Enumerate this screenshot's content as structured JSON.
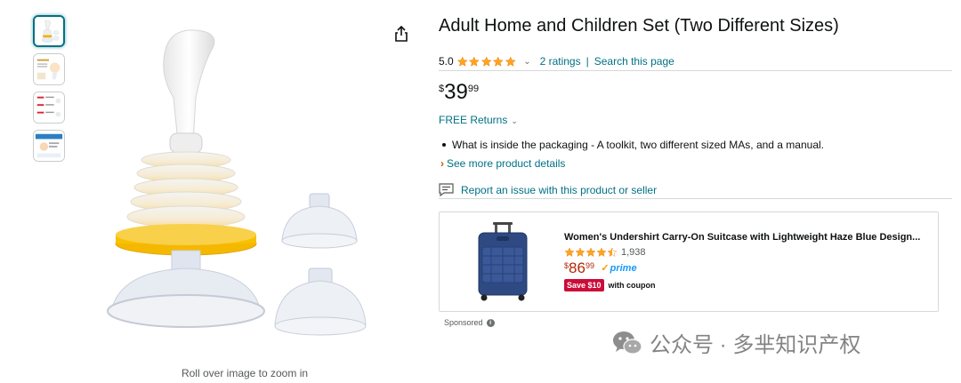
{
  "gallery": {
    "thumbnails": [
      "product-photo",
      "infographic",
      "size-comparison",
      "usage-guide"
    ],
    "zoom_hint": "Roll over image to zoom in"
  },
  "product": {
    "title": "Adult Home and Children Set (Two Different Sizes)",
    "rating_value": "5.0",
    "stars": 5,
    "ratings_link": "2 ratings",
    "search_link": "Search this page",
    "price_symbol": "$",
    "price_whole": "39",
    "price_fraction": "99",
    "returns": "FREE Returns",
    "bullet": "What is inside the packaging - A toolkit, two different sized MAs, and a manual.",
    "see_more": "See more product details",
    "report": "Report an issue with this product or seller"
  },
  "sponsored_ad": {
    "title": "Women's Undershirt Carry-On Suitcase with Lightweight Haze Blue Design...",
    "stars": 4.5,
    "rating_count": "1,938",
    "price_symbol": "$",
    "price_whole": "86",
    "price_fraction": "99",
    "prime": "prime",
    "coupon_badge": "Save $10",
    "coupon_text": "with coupon",
    "label": "Sponsored"
  },
  "watermark": {
    "text": "公众号 · 多芈知识产权"
  },
  "colors": {
    "link": "#007185",
    "star": "#FFA41C",
    "deal_red": "#CC0C39",
    "ad_price": "#B12704",
    "prime_blue": "#1399FF"
  }
}
